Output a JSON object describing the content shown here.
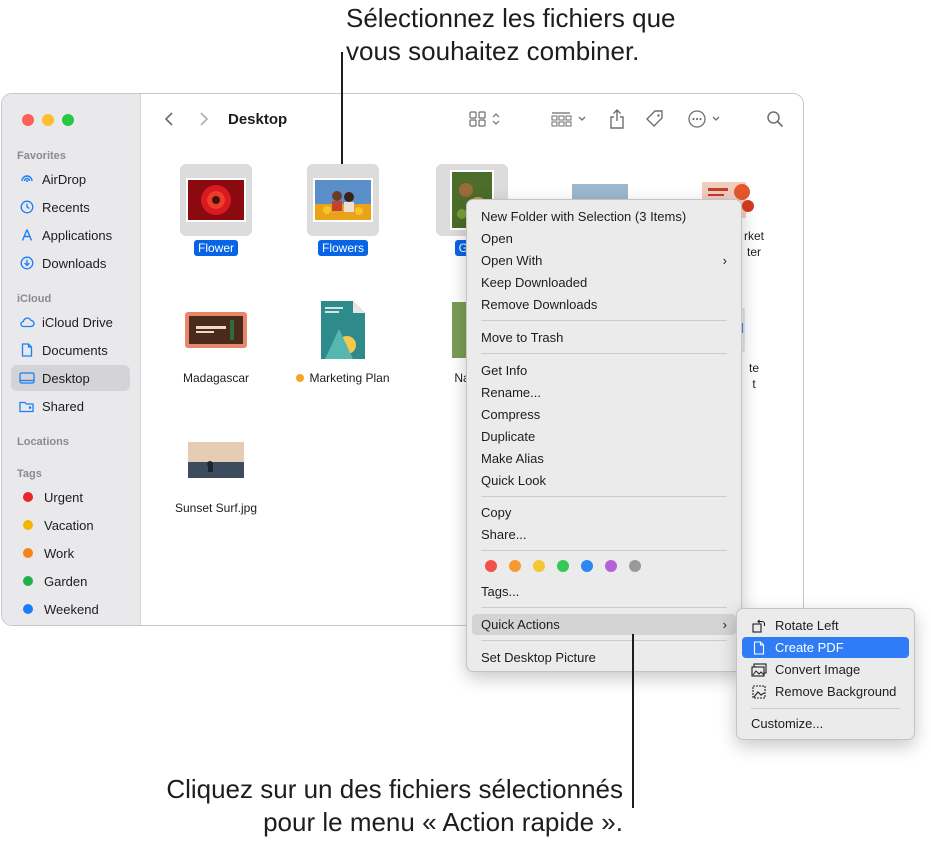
{
  "callouts": {
    "top": [
      "Sélectionnez les fichiers que",
      "vous souhaitez combiner."
    ],
    "bottom": [
      "Cliquez sur un des fichiers sélectionnés",
      "pour le menu « Action rapide »."
    ]
  },
  "window": {
    "title": "Desktop",
    "traffic_colors": [
      "#fe5f57",
      "#febc2e",
      "#28c840"
    ]
  },
  "sidebar": {
    "favorites_header": "Favorites",
    "favorites": [
      {
        "label": "AirDrop",
        "icon": "airdrop-icon"
      },
      {
        "label": "Recents",
        "icon": "clock-icon"
      },
      {
        "label": "Applications",
        "icon": "applications-icon"
      },
      {
        "label": "Downloads",
        "icon": "download-icon"
      }
    ],
    "icloud_header": "iCloud",
    "icloud": [
      {
        "label": "iCloud Drive",
        "icon": "cloud-icon"
      },
      {
        "label": "Documents",
        "icon": "document-icon"
      },
      {
        "label": "Desktop",
        "icon": "desktop-icon"
      },
      {
        "label": "Shared",
        "icon": "shared-folder-icon"
      }
    ],
    "locations_header": "Locations",
    "tags_header": "Tags",
    "tags": [
      {
        "label": "Urgent",
        "color": "#e8252b"
      },
      {
        "label": "Vacation",
        "color": "#f5b400"
      },
      {
        "label": "Work",
        "color": "#f5831f"
      },
      {
        "label": "Garden",
        "color": "#23b04a"
      },
      {
        "label": "Weekend",
        "color": "#1b7ef7"
      }
    ]
  },
  "files": {
    "flower": "Flower",
    "flowers": "Flowers",
    "garden_partial": "Gard",
    "market_partial_1": "rket",
    "market_partial_2": "ter",
    "madagascar": "Madagascar",
    "marketing_plan": "Marketing Plan",
    "marketing_tag_color": "#f5a623",
    "na_partial": "Na",
    "right_partial_1": "te",
    "right_partial_2": "t",
    "sunset": "Sunset Surf.jpg"
  },
  "context_menu": {
    "new_folder": "New Folder with Selection (3 Items)",
    "open": "Open",
    "open_with": "Open With",
    "keep_downloaded": "Keep Downloaded",
    "remove_downloads": "Remove Downloads",
    "move_to_trash": "Move to Trash",
    "get_info": "Get Info",
    "rename": "Rename...",
    "compress": "Compress",
    "duplicate": "Duplicate",
    "make_alias": "Make Alias",
    "quick_look": "Quick Look",
    "copy": "Copy",
    "share": "Share...",
    "tag_colors": [
      "#f0514a",
      "#f39a33",
      "#f5c634",
      "#36c759",
      "#2f86f0",
      "#b560d8",
      "#9a9a9e"
    ],
    "tags": "Tags...",
    "quick_actions": "Quick Actions",
    "set_desktop_picture": "Set Desktop Picture",
    "submenu_arrow": "›"
  },
  "quick_actions_menu": {
    "rotate_left": "Rotate Left",
    "create_pdf": "Create PDF",
    "convert_image": "Convert Image",
    "remove_background": "Remove Background",
    "customize": "Customize..."
  },
  "colors": {
    "accent": "#2f7cf6",
    "selection": "#0864e6"
  }
}
